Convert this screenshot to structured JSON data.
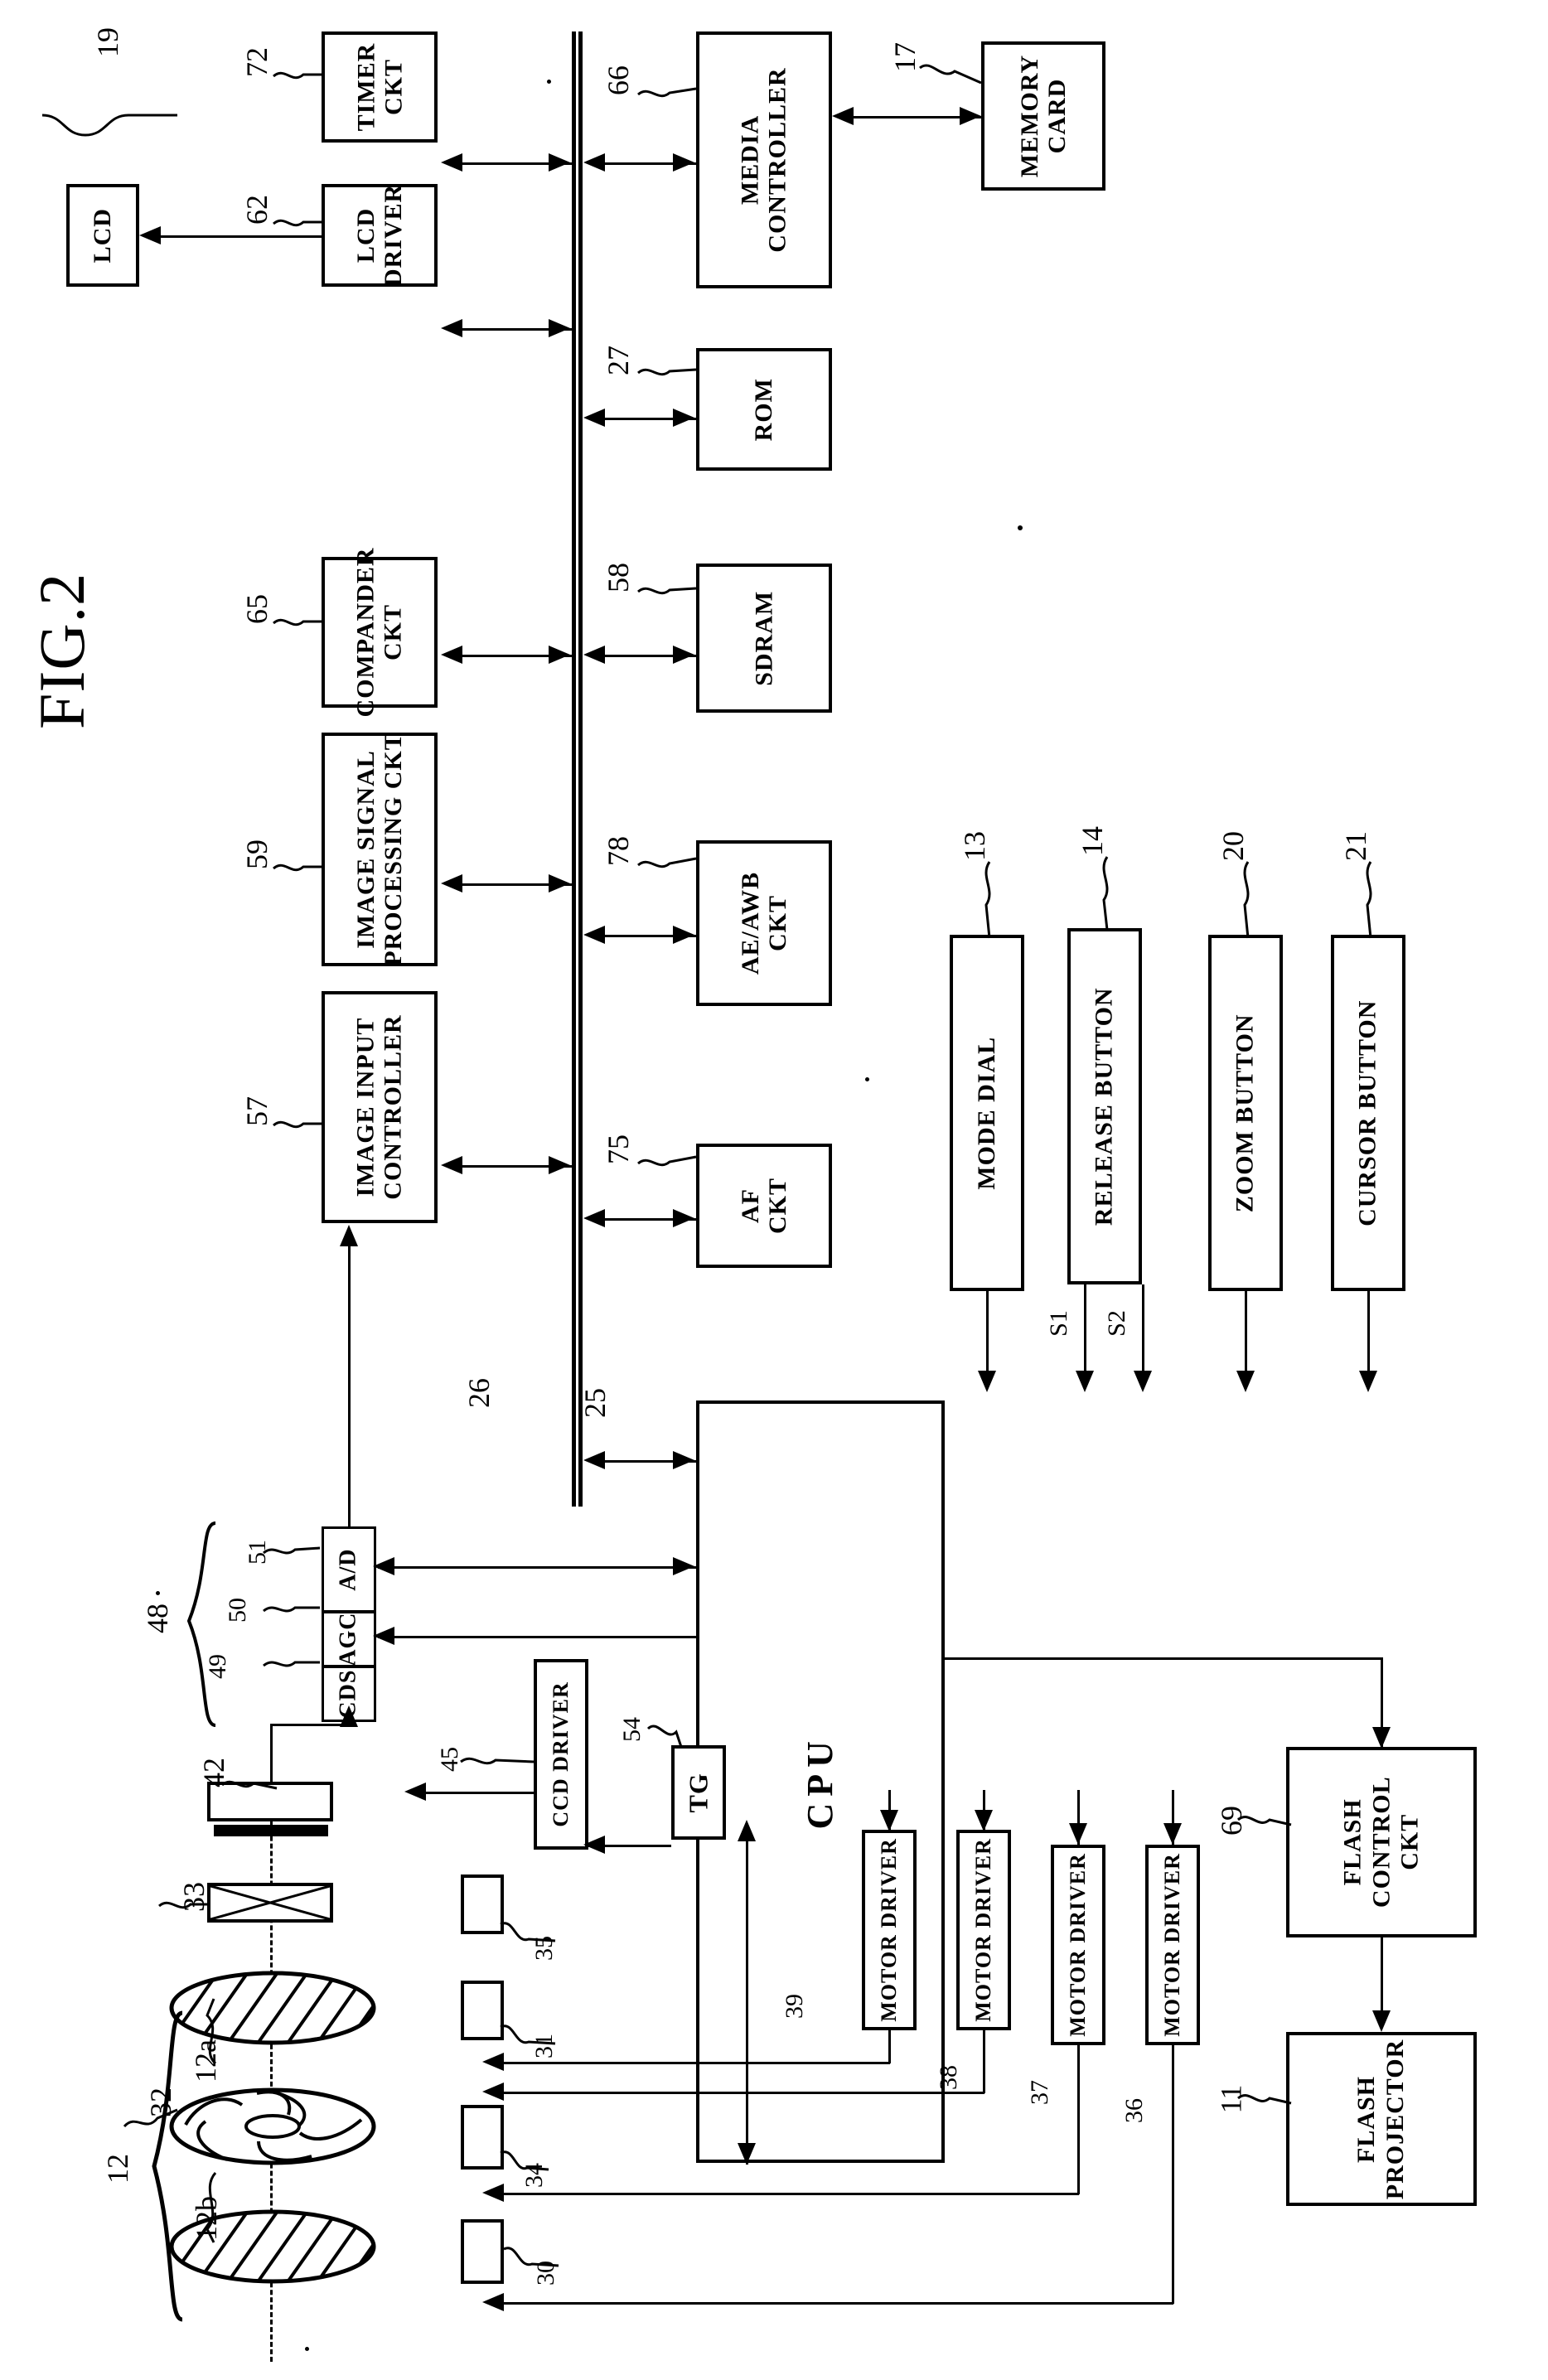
{
  "figure": {
    "title": "FIG.2",
    "type": "patent-block-diagram",
    "orientation": "rotated-90-ccw"
  },
  "blocks": [
    {
      "id": "lcd",
      "label": "LCD",
      "ref": "19"
    },
    {
      "id": "lcd_driver",
      "label": "LCD\nDRIVER",
      "ref": "62"
    },
    {
      "id": "timer_ckt",
      "label": "TIMER\nCKT",
      "ref": "72"
    },
    {
      "id": "media_controller",
      "label": "MEDIA\nCONTROLLER",
      "ref": "66"
    },
    {
      "id": "memory_card",
      "label": "MEMORY\nCARD",
      "ref": "17"
    },
    {
      "id": "rom",
      "label": "ROM",
      "ref": "27"
    },
    {
      "id": "sdram",
      "label": "SDRAM",
      "ref": "58"
    },
    {
      "id": "compander_ckt",
      "label": "COMPANDER\nCKT",
      "ref": "65"
    },
    {
      "id": "image_signal",
      "label": "IMAGE SIGNAL\nPROCESSING CKT",
      "ref": "59"
    },
    {
      "id": "ae_awb_ckt",
      "label": "AE/AWB\nCKT",
      "ref": "78"
    },
    {
      "id": "af_ckt",
      "label": "AF\nCKT",
      "ref": "75"
    },
    {
      "id": "image_input",
      "label": "IMAGE INPUT\nCONTROLLER",
      "ref": "57"
    },
    {
      "id": "mode_dial",
      "label": "MODE DIAL",
      "ref": "13"
    },
    {
      "id": "release_button",
      "label": "RELEASE BUTTON",
      "ref": "14"
    },
    {
      "id": "zoom_button",
      "label": "ZOOM BUTTON",
      "ref": "20"
    },
    {
      "id": "cursor_button",
      "label": "CURSOR BUTTON",
      "ref": "21"
    },
    {
      "id": "cpu",
      "label": "CPU",
      "ref": ""
    },
    {
      "id": "ad",
      "label": "A/D",
      "ref": "51"
    },
    {
      "id": "agc",
      "label": "AGC",
      "ref": "50"
    },
    {
      "id": "cds",
      "label": "CDS",
      "ref": "49"
    },
    {
      "id": "ccd_driver",
      "label": "CCD DRIVER",
      "ref": "45"
    },
    {
      "id": "tg",
      "label": "TG",
      "ref": "54"
    },
    {
      "id": "motor_driver_1",
      "label": "MOTOR DRIVER",
      "ref": "39"
    },
    {
      "id": "motor_driver_2",
      "label": "MOTOR DRIVER",
      "ref": "38"
    },
    {
      "id": "motor_driver_3",
      "label": "MOTOR DRIVER",
      "ref": "37"
    },
    {
      "id": "motor_driver_4",
      "label": "MOTOR DRIVER",
      "ref": "36"
    },
    {
      "id": "flash_control",
      "label": "FLASH\nCONTROL\nCKT",
      "ref": "69"
    },
    {
      "id": "flash_projector",
      "label": "FLASH\nPROJECTOR",
      "ref": "11"
    }
  ],
  "labels": {
    "title": "FIG.2",
    "lcd": "LCD",
    "lcd_driver_1": "LCD",
    "lcd_driver_2": "DRIVER",
    "timer_1": "TIMER",
    "timer_2": "CKT",
    "media_1": "MEDIA",
    "media_2": "CONTROLLER",
    "memcard_1": "MEMORY",
    "memcard_2": "CARD",
    "rom": "ROM",
    "sdram": "SDRAM",
    "compander_1": "COMPANDER",
    "compander_2": "CKT",
    "isp_1": "IMAGE SIGNAL",
    "isp_2": "PROCESSING CKT",
    "aeawb_1": "AE/AWB",
    "aeawb_2": "CKT",
    "af_1": "AF",
    "af_2": "CKT",
    "iic_1": "IMAGE INPUT",
    "iic_2": "CONTROLLER",
    "mode_dial": "MODE DIAL",
    "release_button": "RELEASE BUTTON",
    "zoom_button": "ZOOM BUTTON",
    "cursor_button": "CURSOR BUTTON",
    "cpu": "CPU",
    "ad": "A/D",
    "agc": "AGC",
    "cds": "CDS",
    "ccd_driver": "CCD DRIVER",
    "tg": "TG",
    "motor_driver": "MOTOR DRIVER",
    "flash_control_1": "FLASH",
    "flash_control_2": "CONTROL",
    "flash_control_3": "CKT",
    "flash_projector_1": "FLASH",
    "flash_projector_2": "PROJECTOR"
  },
  "reference_numerals": {
    "lcd": "19",
    "lcd_driver": "62",
    "timer": "72",
    "media_controller": "66",
    "memory_card": "17",
    "rom": "27",
    "sdram": "58",
    "compander": "65",
    "isp": "59",
    "ae_awb": "78",
    "af": "75",
    "image_input_controller": "57",
    "bus_left": "26",
    "bus_right": "25",
    "mode_dial": "13",
    "release_button": "14",
    "zoom_button": "20",
    "cursor_button": "21",
    "afe_bracket": "48",
    "ad": "51",
    "agc": "50",
    "cds": "49",
    "ccd_driver": "45",
    "tg": "54",
    "ccd": "42",
    "iris_holder": "35",
    "nd_filter": "33",
    "motor_driver_39": "39",
    "motor_driver_38": "38",
    "motor_driver_37": "37",
    "motor_driver_36": "36",
    "holder_31": "31",
    "holder_34": "34",
    "holder_30": "30",
    "aperture": "32",
    "lens_group": "12",
    "lens_front": "12a",
    "lens_rear": "12b",
    "flash_control": "69",
    "flash_projector": "11"
  },
  "signal_labels": {
    "s1": "S1",
    "s2": "S2"
  }
}
